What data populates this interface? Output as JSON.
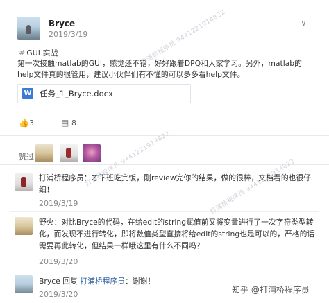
{
  "post": {
    "author": "Bryce",
    "date": "2019/3/19",
    "expand_icon": "chevron-down",
    "tag": "GUI 实战",
    "body": "第一次接触matlab的GUI，感觉还不错，好好跟着DPQ和大家学习。另外，matlab的help文件真的很管用，建议小伙伴们有不懂的可以多多看help文件。",
    "attachment": {
      "icon_letter": "W",
      "file_name": "任务_1_Bryce.docx"
    },
    "likes": "3",
    "comments": "8"
  },
  "likes_section": {
    "label": "赞过"
  },
  "comments": [
    {
      "text": "打浦桥程序员：才下班吃完饭，刚review完你的结果，做的很棒，文档看的也很仔细！",
      "date": "2019/3/19"
    },
    {
      "text": "野火：对比Bryce的代码，在给edit的string赋值前又将变量进行了一次字符类型转化，而发现不进行转化，即将数值类型直接将给edit的string也是可以的，严格的话需要再此转化，但结果一样哦这里有什么不同吗？",
      "date": "2019/3/20"
    },
    {
      "author": "Bryce",
      "reply_word": " 回复 ",
      "reply_to": "打浦桥程序员",
      "text": "：谢谢！",
      "date": "2019/3/20"
    }
  ],
  "footer": {
    "brand": "知乎 @打浦桥程序员"
  },
  "watermark_text": "打浦桥程序员 9441221914822"
}
